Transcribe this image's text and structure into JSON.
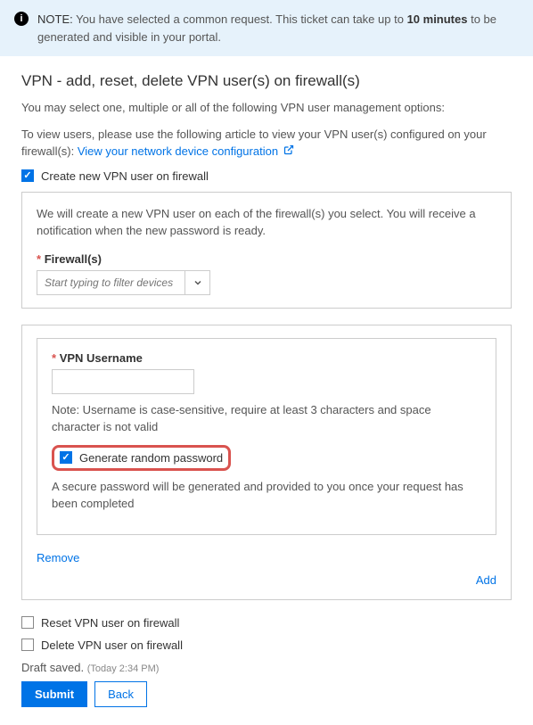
{
  "note": {
    "label": "NOTE:",
    "text_before": " You have selected a common request. This ticket can take up to ",
    "bold": "10 minutes",
    "text_after": " to be generated and visible in your portal."
  },
  "title": "VPN - add, reset, delete VPN user(s) on firewall(s)",
  "intro1": "You may select one, multiple or all of the following VPN user management options:",
  "intro2_prefix": "To view users, please use the following article to view your VPN user(s) configured on your firewall(s): ",
  "intro2_link": "View your network device configuration",
  "create_label": "Create new VPN user on firewall",
  "create_panel": {
    "desc": "We will create a new VPN user on each of the firewall(s) you select. You will receive a notification when the new password is ready.",
    "firewalls_label": "Firewall(s)",
    "firewalls_placeholder": "Start typing to filter devices"
  },
  "user_panel": {
    "username_label": "VPN Username",
    "username_hint": "Note: Username is case-sensitive, require at least 3 characters and space character is not valid",
    "gen_pw_label": "Generate random password",
    "gen_pw_hint": "A secure password will be generated and provided to you once your request has been completed",
    "remove": "Remove",
    "add": "Add"
  },
  "reset_label": "Reset VPN user on firewall",
  "delete_label": "Delete VPN user on firewall",
  "draft": {
    "text": "Draft saved.",
    "time": "(Today 2:34 PM)"
  },
  "buttons": {
    "submit": "Submit",
    "back": "Back"
  }
}
